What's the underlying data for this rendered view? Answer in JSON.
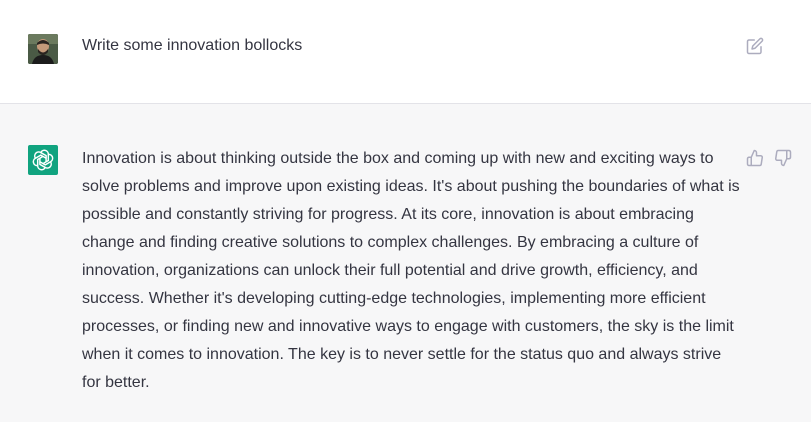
{
  "user_message": {
    "text": "Write some innovation bollocks"
  },
  "assistant_message": {
    "text": "Innovation is about thinking outside the box and coming up with new and exciting ways to solve problems and improve upon existing ideas. It's about pushing the boundaries of what is possible and constantly striving for progress. At its core, innovation is about embracing change and finding creative solutions to complex challenges. By embracing a culture of innovation, organizations can unlock their full potential and drive growth, efficiency, and success. Whether it's developing cutting-edge technologies, implementing more efficient processes, or finding new and innovative ways to engage with customers, the sky is the limit when it comes to innovation. The key is to never settle for the status quo and always strive for better."
  },
  "icons": {
    "edit": "edit-icon",
    "thumbs_up": "thumbs-up-icon",
    "thumbs_down": "thumbs-down-icon",
    "assistant_logo": "openai-logo-icon"
  },
  "colors": {
    "assistant_logo_bg": "#10a37f",
    "assistant_row_bg": "#f7f7f8",
    "text": "#343541",
    "icon": "#acacbe"
  }
}
